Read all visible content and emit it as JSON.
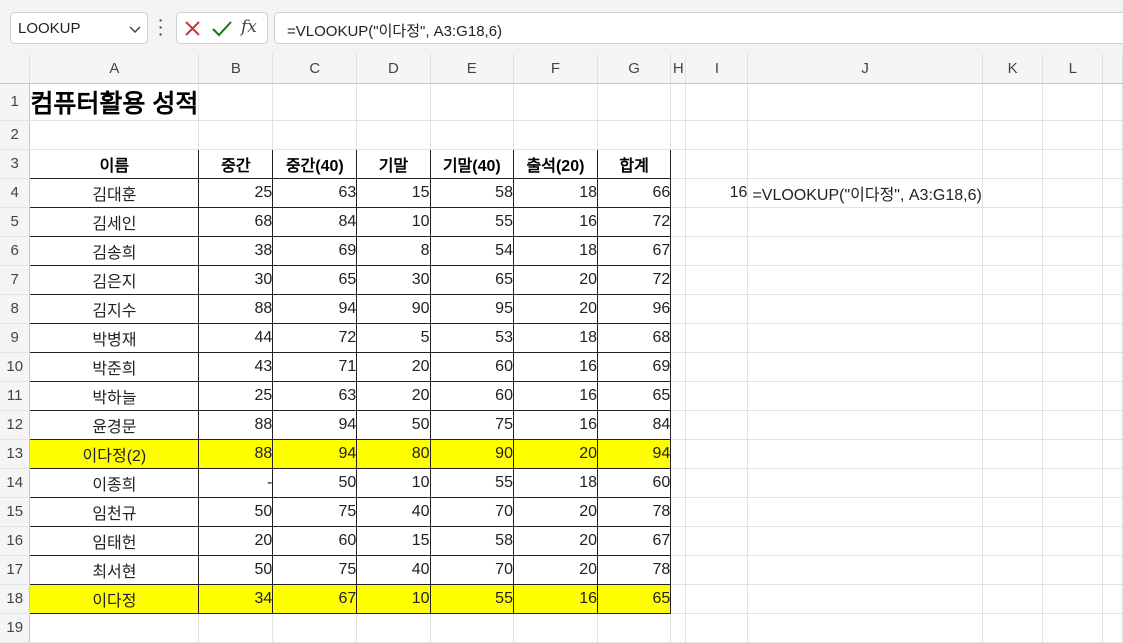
{
  "formula_bar": {
    "name_box": "LOOKUP",
    "formula": "=VLOOKUP(\"이다정\", A3:G18,6)"
  },
  "columns": [
    "A",
    "B",
    "C",
    "D",
    "E",
    "F",
    "G",
    "H",
    "I",
    "J",
    "K",
    "L"
  ],
  "sheet": {
    "title": "컴퓨터활용 성적",
    "headers": [
      "이름",
      "중간",
      "중간(40)",
      "기말",
      "기말(40)",
      "출석(20)",
      "합계"
    ],
    "rows": [
      [
        "김대훈",
        "25",
        "63",
        "15",
        "58",
        "18",
        "66"
      ],
      [
        "김세인",
        "68",
        "84",
        "10",
        "55",
        "16",
        "72"
      ],
      [
        "김송희",
        "38",
        "69",
        "8",
        "54",
        "18",
        "67"
      ],
      [
        "김은지",
        "30",
        "65",
        "30",
        "65",
        "20",
        "72"
      ],
      [
        "김지수",
        "88",
        "94",
        "90",
        "95",
        "20",
        "96"
      ],
      [
        "박병재",
        "44",
        "72",
        "5",
        "53",
        "18",
        "68"
      ],
      [
        "박준희",
        "43",
        "71",
        "20",
        "60",
        "16",
        "69"
      ],
      [
        "박하늘",
        "25",
        "63",
        "20",
        "60",
        "16",
        "65"
      ],
      [
        "윤경문",
        "88",
        "94",
        "50",
        "75",
        "16",
        "84"
      ],
      [
        "이다정(2)",
        "88",
        "94",
        "80",
        "90",
        "20",
        "94"
      ],
      [
        "이종희",
        "-",
        "50",
        "10",
        "55",
        "18",
        "60"
      ],
      [
        "임천규",
        "50",
        "75",
        "40",
        "70",
        "20",
        "78"
      ],
      [
        "임태헌",
        "20",
        "60",
        "15",
        "58",
        "20",
        "67"
      ],
      [
        "최서현",
        "50",
        "75",
        "40",
        "70",
        "20",
        "78"
      ],
      [
        "이다정",
        "34",
        "67",
        "10",
        "55",
        "16",
        "65"
      ]
    ],
    "highlight_color": "#ffff00",
    "side_value": "16",
    "side_formula": "=VLOOKUP(\"이다정\", A3:G18,6)"
  }
}
